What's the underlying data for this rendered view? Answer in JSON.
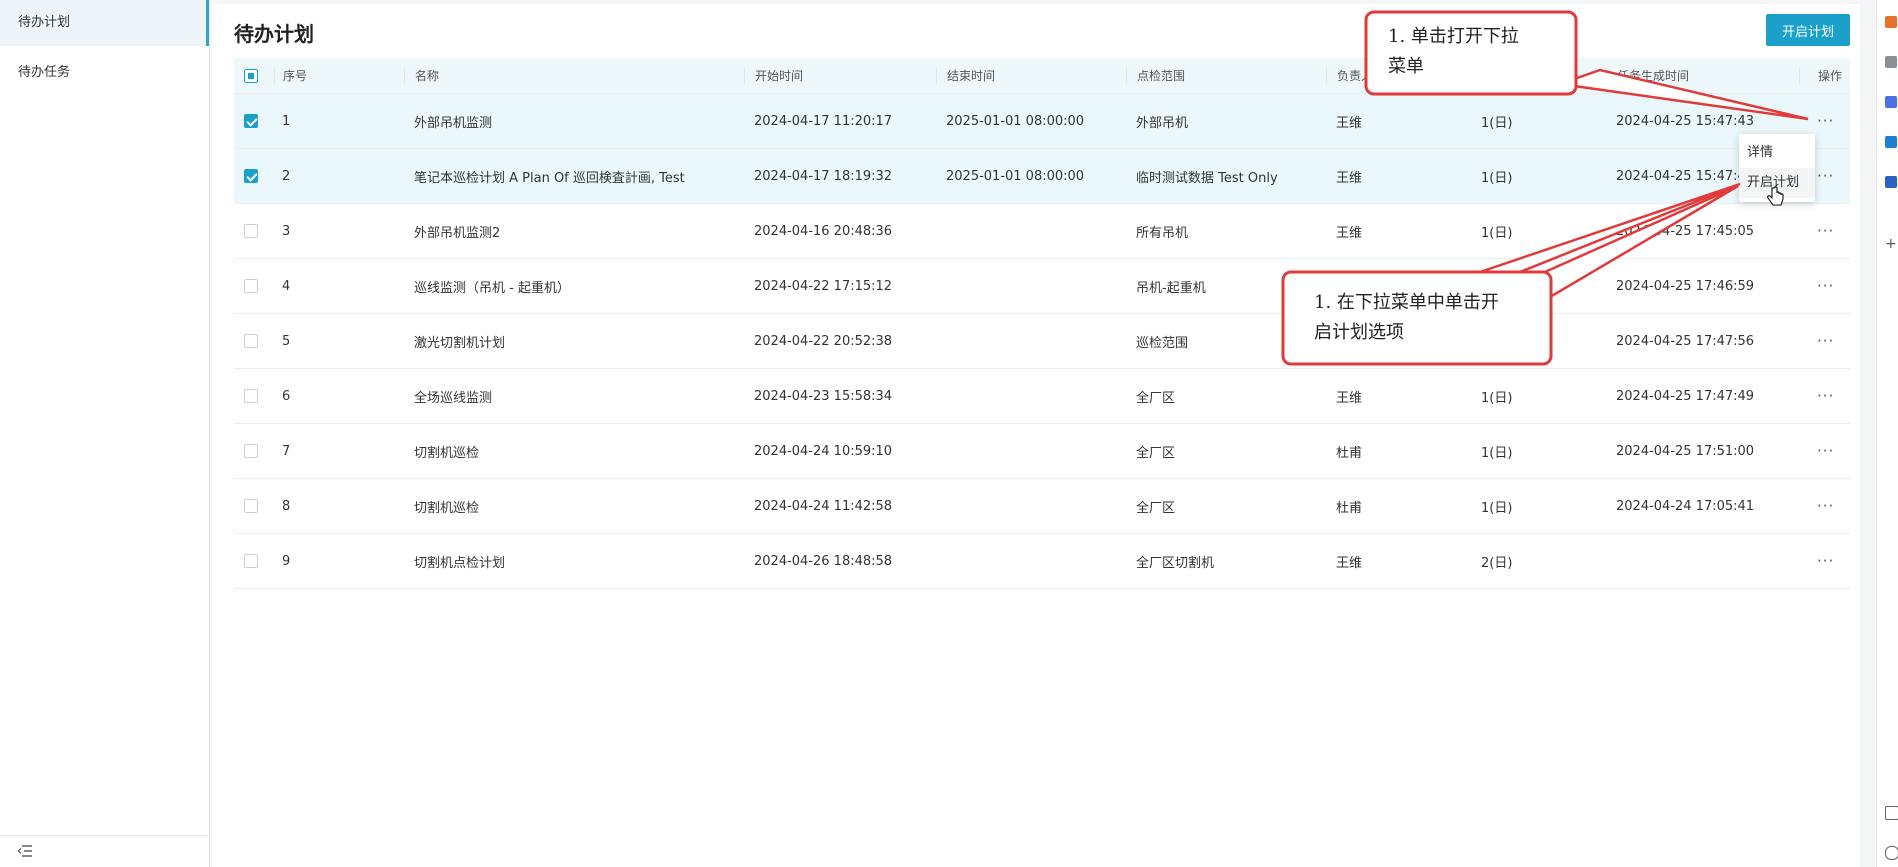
{
  "sidebar": {
    "items": [
      {
        "label": "待办计划",
        "active": true
      },
      {
        "label": "待办任务",
        "active": false
      }
    ],
    "collapse_icon": "menu-collapse-icon"
  },
  "page": {
    "title": "待办计划",
    "primary_button": "开启计划"
  },
  "table": {
    "headers": [
      "序号",
      "名称",
      "开始时间",
      "结束时间",
      "点检范围",
      "负责人",
      "",
      "任务生成时间",
      "操作"
    ],
    "rows": [
      {
        "checked": true,
        "idx": "1",
        "name": "外部吊机监测",
        "start": "2024-04-17 11:20:17",
        "end": "2025-01-01 08:00:00",
        "scope": "外部吊机",
        "owner": "王维",
        "cycle": "1(日)",
        "gen": "2024-04-25 15:47:43",
        "op": "···"
      },
      {
        "checked": true,
        "idx": "2",
        "name": "笔记本巡检计划 A Plan Of 巡回検査計画, Test",
        "start": "2024-04-17 18:19:32",
        "end": "2025-01-01 08:00:00",
        "scope": "临时测试数据 Test Only",
        "owner": "王维",
        "cycle": "1(日)",
        "gen": "2024-04-25 15:47:43",
        "op": "···"
      },
      {
        "checked": false,
        "idx": "3",
        "name": "外部吊机监测2",
        "start": "2024-04-16 20:48:36",
        "end": "",
        "scope": "所有吊机",
        "owner": "王维",
        "cycle": "1(日)",
        "gen": "2024-04-25 17:45:05",
        "op": "···"
      },
      {
        "checked": false,
        "idx": "4",
        "name": "巡线监测（吊机 - 起重机）",
        "start": "2024-04-22 17:15:12",
        "end": "",
        "scope": "吊机-起重机",
        "owner": "",
        "cycle": "",
        "gen": "2024-04-25 17:46:59",
        "op": "···"
      },
      {
        "checked": false,
        "idx": "5",
        "name": "激光切割机计划",
        "start": "2024-04-22 20:52:38",
        "end": "",
        "scope": "巡检范围",
        "owner": "",
        "cycle": "",
        "gen": "2024-04-25 17:47:56",
        "op": "···"
      },
      {
        "checked": false,
        "idx": "6",
        "name": "全场巡线监测",
        "start": "2024-04-23 15:58:34",
        "end": "",
        "scope": "全厂区",
        "owner": "王维",
        "cycle": "1(日)",
        "gen": "2024-04-25 17:47:49",
        "op": "···"
      },
      {
        "checked": false,
        "idx": "7",
        "name": "切割机巡检",
        "start": "2024-04-24 10:59:10",
        "end": "",
        "scope": "全厂区",
        "owner": "杜甫",
        "cycle": "1(日)",
        "gen": "2024-04-25 17:51:00",
        "op": "···"
      },
      {
        "checked": false,
        "idx": "8",
        "name": "切割机巡检",
        "start": "2024-04-24 11:42:58",
        "end": "",
        "scope": "全厂区",
        "owner": "杜甫",
        "cycle": "1(日)",
        "gen": "2024-04-24 17:05:41",
        "op": "···"
      },
      {
        "checked": false,
        "idx": "9",
        "name": "切割机点检计划",
        "start": "2024-04-26 18:48:58",
        "end": "",
        "scope": "全厂区切割机",
        "owner": "王维",
        "cycle": "2(日)",
        "gen": "",
        "op": "···"
      }
    ]
  },
  "dropdown": {
    "items": [
      "详情",
      "开启计划"
    ]
  },
  "callouts": {
    "first_line1": "1. 单击打开下拉",
    "first_line2": "菜单",
    "second_line1": "1. 在下拉菜单中单击开",
    "second_line2": "启计划选项"
  },
  "colors": {
    "accent": "#1ba1c9",
    "callout_border": "#e03a3a",
    "selected_row": "#eaf8fb"
  }
}
